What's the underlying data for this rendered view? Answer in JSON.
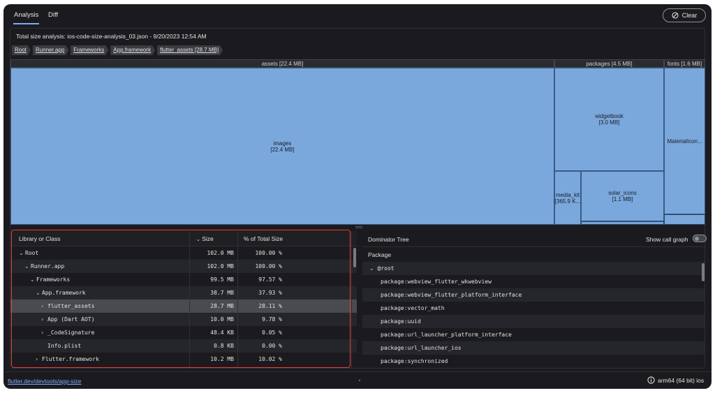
{
  "tabs": [
    {
      "label": "Analysis",
      "active": true
    },
    {
      "label": "Diff",
      "active": false
    }
  ],
  "clear_label": "Clear",
  "summary": "Total size analysis: ios-code-size-analysis_03.json - 9/20/2023 12:54 AM",
  "breadcrumbs": [
    "Root",
    "Runner.app",
    "Frameworks",
    "App.framework",
    "flutter_assets [28.7 MB]"
  ],
  "treemap": {
    "headers": [
      "assets [22.4 MB]",
      "packages [4.5 MB]",
      "fonts [1.6 MB]"
    ],
    "cells": {
      "images": {
        "name": "images",
        "size": "[22.4 MB]"
      },
      "widgetbook": {
        "name": "widgetbook",
        "size": "[3.0 MB]"
      },
      "media_kit": {
        "name": "media_kit",
        "size": "[365.9 K..."
      },
      "solar_icons": {
        "name": "solar_icons",
        "size": "[1.1 MB]"
      },
      "material_icons": {
        "name": "MaterialIcon..."
      }
    }
  },
  "library_table": {
    "headers": {
      "name": "Library or Class",
      "size": "Size",
      "pct": "% of Total Size"
    },
    "rows": [
      {
        "name": "Root",
        "size": "102.0 MB",
        "pct": "100.00 %",
        "expander": "v"
      },
      {
        "name": "Runner.app",
        "size": "102.0 MB",
        "pct": "100.00 %",
        "expander": "v"
      },
      {
        "name": "Frameworks",
        "size": "99.5 MB",
        "pct": "97.57 %",
        "expander": "v"
      },
      {
        "name": "App.framework",
        "size": "38.7 MB",
        "pct": "37.93 %",
        "expander": "v"
      },
      {
        "name": "flutter_assets",
        "size": "28.7 MB",
        "pct": "28.11 %",
        "expander": ">"
      },
      {
        "name": "App (Dart AOT)",
        "size": "10.0 MB",
        "pct": "9.78 %",
        "expander": ">"
      },
      {
        "name": "_CodeSignature",
        "size": "48.4 KB",
        "pct": "0.05 %",
        "expander": ">"
      },
      {
        "name": "Info.plist",
        "size": "0.8 KB",
        "pct": "0.00 %",
        "expander": ""
      },
      {
        "name": "Flutter.framework",
        "size": "10.2 MB",
        "pct": "10.02 %",
        "expander": ">"
      }
    ]
  },
  "dominator": {
    "title": "Dominator Tree",
    "call_graph_label": "Show call graph",
    "column": "Package",
    "rows": [
      "@root",
      "package:webview_flutter_wkwebview",
      "package:webview_flutter_platform_interface",
      "package:vector_math",
      "package:uuid",
      "package:url_launcher_platform_interface",
      "package:url_launcher_ios",
      "package:synchronized"
    ]
  },
  "footer": {
    "link": "flutter.dev/devtools/app-size",
    "arch": "arm64 (64 bit) ios"
  },
  "icons": {
    "clear": "block-icon",
    "info": "info-icon"
  }
}
